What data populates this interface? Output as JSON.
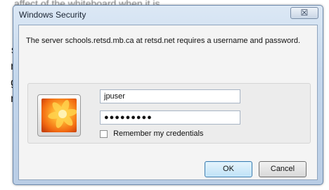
{
  "background": {
    "top_text": "affect of the whiteboard when it is",
    "left_fragments": [
      "s",
      "n",
      "g",
      "n",
      "-"
    ]
  },
  "window": {
    "title": "Windows Security",
    "close_glyph": "☒"
  },
  "dialog": {
    "message": "The server schools.retsd.mb.ca at retsd.net requires a username and password.",
    "user_tile_icon": "flower-user-picture",
    "username_value": "jpuser",
    "password_mask": "●●●●●●●●●",
    "remember_label": "Remember my credentials",
    "remember_checked": false
  },
  "buttons": {
    "ok_label": "OK",
    "cancel_label": "Cancel"
  },
  "colors": {
    "frame": "#c4d7ec",
    "ok_button": "#bfe2f7"
  }
}
